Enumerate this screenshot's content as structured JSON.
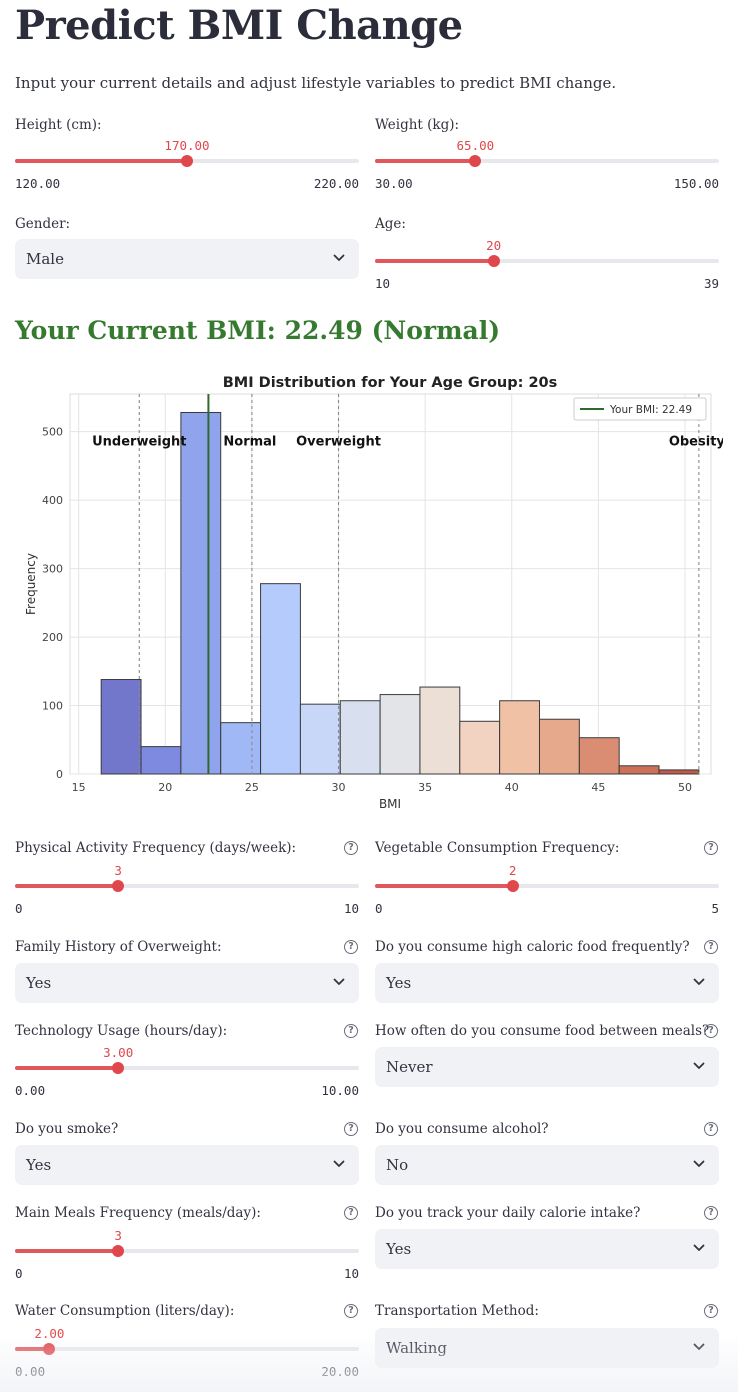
{
  "page": {
    "title": "Predict BMI Change",
    "subtitle": "Input your current details and adjust lifestyle variables to predict BMI change."
  },
  "inputs": {
    "height": {
      "label": "Height (cm):",
      "value": "170.00",
      "min": "120.00",
      "max": "220.00",
      "fraction": 0.5
    },
    "weight": {
      "label": "Weight (kg):",
      "value": "65.00",
      "min": "30.00",
      "max": "150.00",
      "fraction": 0.2917
    },
    "gender": {
      "label": "Gender:",
      "value": "Male"
    },
    "age": {
      "label": "Age:",
      "value": "20",
      "min": "10",
      "max": "39",
      "fraction": 0.3448
    }
  },
  "current_bmi": {
    "text": "Your Current BMI: 22.49 (Normal)",
    "value": 22.49,
    "category": "Normal"
  },
  "chart_data": {
    "type": "bar",
    "title": "BMI Distribution for Your Age Group: 20s",
    "xlabel": "BMI",
    "ylabel": "Frequency",
    "xlim": [
      14.5,
      51.5
    ],
    "ylim": [
      0,
      555
    ],
    "xticks": [
      15,
      20,
      25,
      30,
      35,
      40,
      45,
      50
    ],
    "yticks": [
      0,
      100,
      200,
      300,
      400,
      500
    ],
    "grid": true,
    "bin_edges": [
      16.3,
      18.6,
      20.9,
      23.2,
      25.5,
      27.8,
      30.1,
      32.4,
      34.7,
      37.0,
      39.3,
      41.6,
      43.9,
      46.2,
      48.5,
      50.8
    ],
    "counts": [
      138,
      40,
      528,
      75,
      278,
      102,
      107,
      116,
      127,
      77,
      107,
      80,
      53,
      12,
      6
    ],
    "colors": [
      "#7277cc",
      "#7e8ae0",
      "#90a4ee",
      "#a1b8f7",
      "#b5cbfb",
      "#c8d7f8",
      "#d8e0f0",
      "#e3e4e7",
      "#ecdfd6",
      "#f2d2c1",
      "#f0c1a5",
      "#e7a98b",
      "#da8d72",
      "#cc7059",
      "#bf5a4a"
    ],
    "category_lines": [
      18.5,
      25,
      30,
      50.8
    ],
    "category_labels": [
      {
        "text": "Underweight",
        "x": 18.5
      },
      {
        "text": "Normal",
        "x": 25
      },
      {
        "text": "Overweight",
        "x": 30
      },
      {
        "text": "Obesity",
        "x": 50.8
      }
    ],
    "user_bmi": 22.49,
    "legend": {
      "label": "Your BMI: 22.49",
      "placement": "top-right"
    }
  },
  "lifestyle": {
    "physical_activity": {
      "label": "Physical Activity Frequency (days/week):",
      "value": "3",
      "min": "0",
      "max": "10",
      "fraction": 0.3
    },
    "vegetable": {
      "label": "Vegetable Consumption Frequency:",
      "value": "2",
      "min": "0",
      "max": "5",
      "fraction": 0.4
    },
    "family_history": {
      "label": "Family History of Overweight:",
      "value": "Yes"
    },
    "high_caloric": {
      "label": "Do you consume high caloric food frequently?",
      "value": "Yes"
    },
    "technology": {
      "label": "Technology Usage (hours/day):",
      "value": "3.00",
      "min": "0.00",
      "max": "10.00",
      "fraction": 0.3
    },
    "between_meals": {
      "label": "How often do you consume food between meals?",
      "value": "Never"
    },
    "smoke": {
      "label": "Do you smoke?",
      "value": "Yes"
    },
    "alcohol": {
      "label": "Do you consume alcohol?",
      "value": "No"
    },
    "main_meals": {
      "label": "Main Meals Frequency (meals/day):",
      "value": "3",
      "min": "0",
      "max": "10",
      "fraction": 0.3
    },
    "track_calories": {
      "label": "Do you track your daily calorie intake?",
      "value": "Yes"
    },
    "water": {
      "label": "Water Consumption (liters/day):",
      "value": "2.00",
      "min": "0.00",
      "max": "20.00",
      "fraction": 0.1
    },
    "transportation": {
      "label": "Transportation Method:",
      "value": "Walking"
    }
  },
  "icons": {
    "help": "help-circle-icon",
    "dropdown": "chevron-down-icon"
  },
  "help_glyph": "?",
  "colors": {
    "accent": "#e0474c",
    "bmi_normal": "#357a2f",
    "select_bg": "#f0f2f6"
  }
}
